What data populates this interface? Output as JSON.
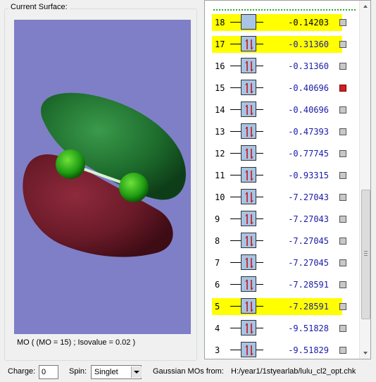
{
  "surface": {
    "group_title": "Current Surface:",
    "caption": "MO ( (MO = 15) ; Isovalue = 0.02 )"
  },
  "mo_list": [
    {
      "num": "18",
      "energy": "-0.14203",
      "occupied": false,
      "highlight": true,
      "checked": false
    },
    {
      "num": "17",
      "energy": "-0.31360",
      "occupied": true,
      "highlight": true,
      "checked": false
    },
    {
      "num": "16",
      "energy": "-0.31360",
      "occupied": true,
      "highlight": false,
      "checked": false
    },
    {
      "num": "15",
      "energy": "-0.40696",
      "occupied": true,
      "highlight": false,
      "checked": true
    },
    {
      "num": "14",
      "energy": "-0.40696",
      "occupied": true,
      "highlight": false,
      "checked": false
    },
    {
      "num": "13",
      "energy": "-0.47393",
      "occupied": true,
      "highlight": false,
      "checked": false
    },
    {
      "num": "12",
      "energy": "-0.77745",
      "occupied": true,
      "highlight": false,
      "checked": false
    },
    {
      "num": "11",
      "energy": "-0.93315",
      "occupied": true,
      "highlight": false,
      "checked": false
    },
    {
      "num": "10",
      "energy": "-7.27043",
      "occupied": true,
      "highlight": false,
      "checked": false
    },
    {
      "num": "9",
      "energy": "-7.27043",
      "occupied": true,
      "highlight": false,
      "checked": false
    },
    {
      "num": "8",
      "energy": "-7.27045",
      "occupied": true,
      "highlight": false,
      "checked": false
    },
    {
      "num": "7",
      "energy": "-7.27045",
      "occupied": true,
      "highlight": false,
      "checked": false
    },
    {
      "num": "6",
      "energy": "-7.28591",
      "occupied": true,
      "highlight": false,
      "checked": false
    },
    {
      "num": "5",
      "energy": "-7.28591",
      "occupied": true,
      "highlight": true,
      "checked": false
    },
    {
      "num": "4",
      "energy": "-9.51828",
      "occupied": true,
      "highlight": false,
      "checked": false
    },
    {
      "num": "3",
      "energy": "-9.51829",
      "occupied": true,
      "highlight": false,
      "checked": false
    }
  ],
  "controls": {
    "charge_label": "Charge:",
    "charge_value": "0",
    "spin_label": "Spin:",
    "spin_value": "Singlet",
    "source_label": "Gaussian MOs from:",
    "source_path": "H:/year1/1styearlab/lulu_cl2_opt.chk"
  },
  "colors": {
    "viewer_bg": "#7f7fc7",
    "positive_lobe": "#1d6b2c",
    "negative_lobe": "#6a1a28",
    "highlight": "#ffff00",
    "energy_text_occupied": "#1a1aa8",
    "energy_text_virtual": "#000000",
    "selected_check": "#d21f1f"
  }
}
